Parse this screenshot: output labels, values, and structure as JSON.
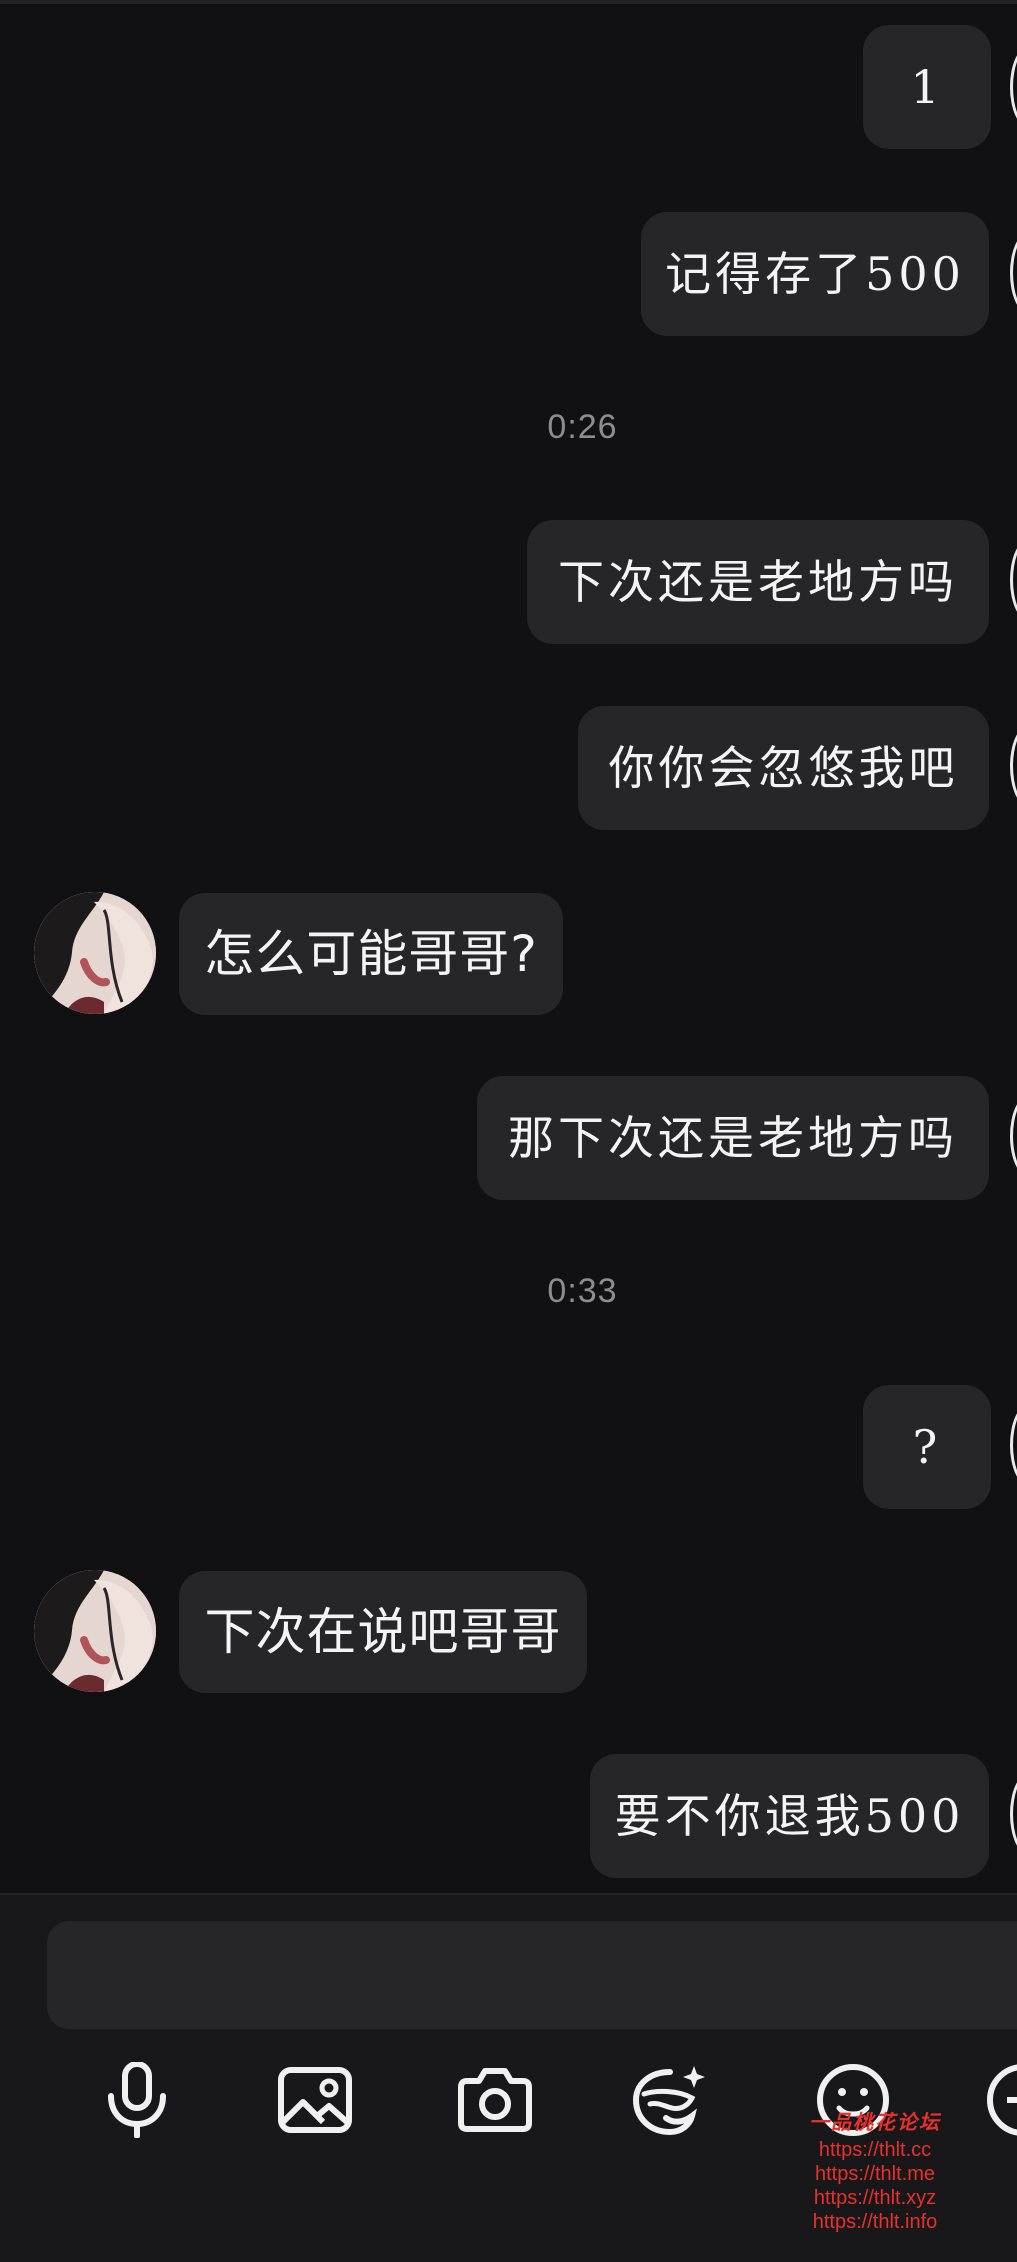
{
  "conversation": {
    "messages": [
      {
        "side": "out",
        "text": "1"
      },
      {
        "side": "out",
        "text": "记得存了500"
      },
      {
        "timestamp": "0:26"
      },
      {
        "side": "out",
        "text": "下次还是老地方吗"
      },
      {
        "side": "out",
        "text": "你你会忽悠我吧"
      },
      {
        "side": "in",
        "text": "怎么可能哥哥?"
      },
      {
        "side": "out",
        "text": "那下次还是老地方吗"
      },
      {
        "timestamp": "0:33"
      },
      {
        "side": "out",
        "text": "?"
      },
      {
        "side": "in",
        "text": "下次在说吧哥哥"
      },
      {
        "side": "out",
        "text": "要不你退我500"
      }
    ]
  },
  "composer": {
    "input_value": "",
    "tools": [
      "microphone-icon",
      "image-icon",
      "camera-icon",
      "sticker-icon",
      "emoji-icon",
      "plus-icon"
    ]
  },
  "watermark": {
    "title": "一品桃花论坛",
    "urls": [
      "https://thlt.cc",
      "https://thlt.me",
      "https://thlt.xyz",
      "https://thlt.info"
    ]
  },
  "colors": {
    "background": "#111113",
    "bubble": "#262628",
    "text": "#f4f4f4",
    "timestamp": "#8d8d91",
    "watermark": "#e8302c"
  }
}
